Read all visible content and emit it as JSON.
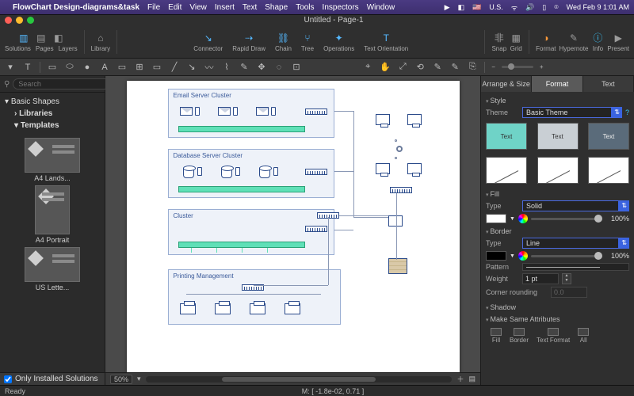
{
  "menubar": {
    "app_name": "FlowChart Design-diagrams&task",
    "items": [
      "File",
      "Edit",
      "View",
      "Insert",
      "Text",
      "Shape",
      "Tools",
      "Inspectors",
      "Window"
    ],
    "status": {
      "flag": "🇺🇸",
      "flag_label": "U.S.",
      "clock": "Wed Feb 9  1:01 AM"
    }
  },
  "window": {
    "title": "Untitled - Page-1"
  },
  "toolbar": {
    "left": [
      {
        "label": "Solutions",
        "icon": "▥"
      },
      {
        "label": "Pages",
        "icon": "▤"
      },
      {
        "label": "Layers",
        "icon": "◧"
      }
    ],
    "library": {
      "label": "Library",
      "icon": "⌂"
    },
    "mid": [
      {
        "label": "Connector",
        "icon": "↘"
      },
      {
        "label": "Rapid Draw",
        "icon": "⇢"
      },
      {
        "label": "Chain",
        "icon": "⛓"
      },
      {
        "label": "Tree",
        "icon": "⑂"
      },
      {
        "label": "Operations",
        "icon": "✦"
      },
      {
        "label": "Text Orientation",
        "icon": "T"
      }
    ],
    "right": [
      {
        "label": "Snap",
        "icon": "⾮"
      },
      {
        "label": "Grid",
        "icon": "▦"
      }
    ],
    "far": [
      {
        "label": "Format",
        "icon": "◑"
      },
      {
        "label": "Hypernote",
        "icon": "✎"
      },
      {
        "label": "Info",
        "icon": "ⓘ"
      },
      {
        "label": "Present",
        "icon": "▶"
      }
    ]
  },
  "toolrow_icons": [
    "▭",
    "T",
    "⬚",
    "⬯",
    "●",
    "A",
    "▭",
    "⊞",
    "▭",
    "↘",
    "⌇",
    "↗",
    "〰",
    "✎",
    "✥",
    "◌",
    "⊡"
  ],
  "toolrow_icons2": [
    "�största",
    "✋",
    "⤢",
    "⟲",
    "✎",
    "✎",
    "⎘"
  ],
  "left_panel": {
    "search_placeholder": "Search",
    "tree_head": "Basic Shapes",
    "tree_items": [
      {
        "label": "Libraries",
        "bold": true
      },
      {
        "label": "Templates",
        "bold": true
      }
    ],
    "thumbs": [
      {
        "label": "A4 Lands...",
        "orient": "land"
      },
      {
        "label": "A4 Portrait",
        "orient": "portrait"
      },
      {
        "label": "US Lette...",
        "orient": "land"
      }
    ],
    "filter_label": "Only Installed Solutions"
  },
  "canvas": {
    "clusters": [
      {
        "title": "Email Server Cluster"
      },
      {
        "title": "Database Server Cluster"
      },
      {
        "title": "Cluster"
      },
      {
        "title": "Printing Management"
      }
    ],
    "zoom": "50%"
  },
  "right_panel": {
    "tabs": [
      "Arrange & Size",
      "Format",
      "Text"
    ],
    "active_tab": 1,
    "style_section": "Style",
    "theme_label": "Theme",
    "theme_value": "Basic Theme",
    "swatch_text": "Text",
    "fill_section": "Fill",
    "type_label": "Type",
    "fill_type": "Solid",
    "fill_pct": "100%",
    "border_section": "Border",
    "border_type": "Line",
    "border_pct": "100%",
    "pattern_label": "Pattern",
    "weight_label": "Weight",
    "weight_value": "1 pt",
    "corner_label": "Corner rounding",
    "corner_value": "0.0",
    "shadow_section": "Shadow",
    "make_same": "Make Same Attributes",
    "attrs": [
      "Fill",
      "Border",
      "Text Format",
      "All"
    ]
  },
  "statusbar": {
    "ready": "Ready",
    "coords": "M: [ -1.8e-02, 0.71 ]"
  }
}
